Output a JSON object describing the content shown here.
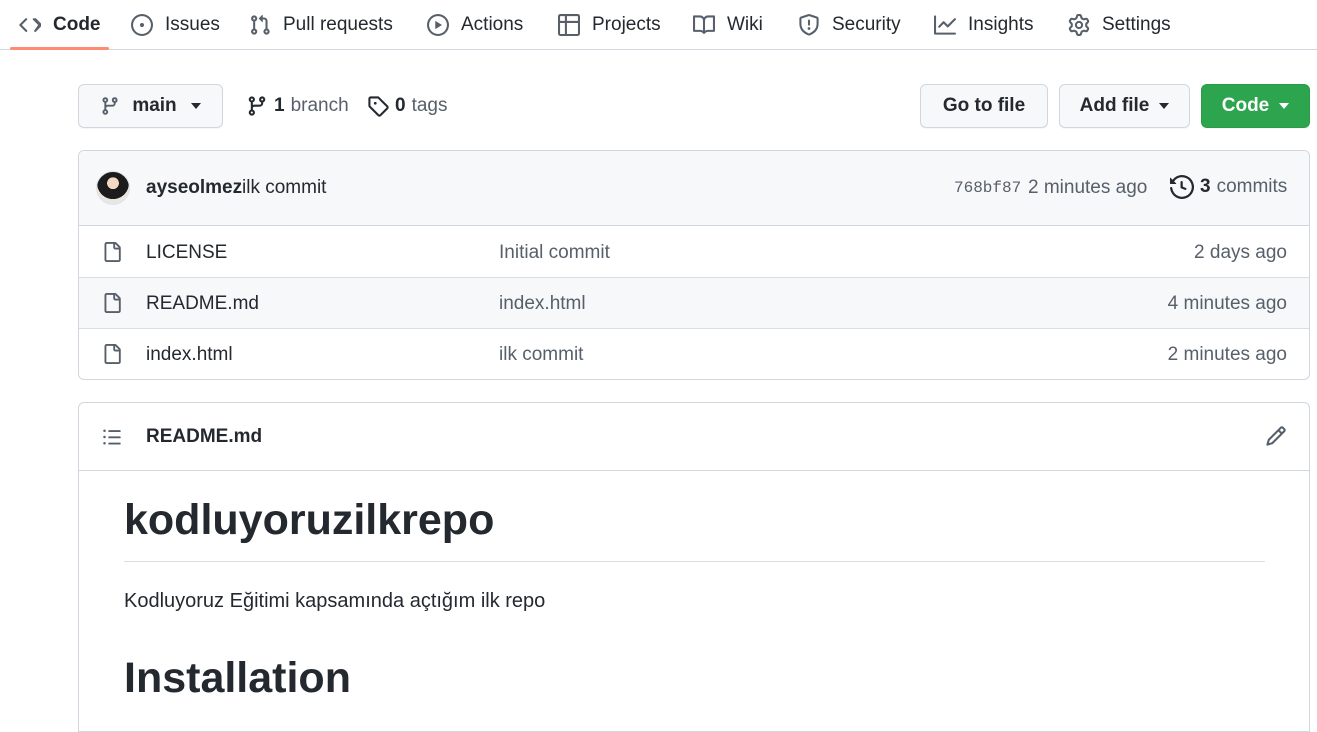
{
  "tabs": [
    {
      "label": "Code",
      "icon": "code-icon",
      "active": true
    },
    {
      "label": "Issues",
      "icon": "issue-opened-icon"
    },
    {
      "label": "Pull requests",
      "icon": "git-pull-request-icon"
    },
    {
      "label": "Actions",
      "icon": "play-icon"
    },
    {
      "label": "Projects",
      "icon": "table-icon"
    },
    {
      "label": "Wiki",
      "icon": "book-icon"
    },
    {
      "label": "Security",
      "icon": "shield-icon"
    },
    {
      "label": "Insights",
      "icon": "graph-icon"
    },
    {
      "label": "Settings",
      "icon": "gear-icon"
    }
  ],
  "branch_bar": {
    "current_branch": "main",
    "branch_count": "1",
    "branch_label": "branch",
    "tag_count": "0",
    "tag_label": "tags",
    "go_to_file": "Go to file",
    "add_file": "Add file",
    "code_button": "Code"
  },
  "latest_commit": {
    "author": "ayseolmez",
    "message": "ilk commit",
    "sha": "768bf87",
    "time": "2 minutes ago",
    "count": "3",
    "count_label": "commits"
  },
  "files": [
    {
      "name": "LICENSE",
      "message": "Initial commit",
      "age": "2 days ago",
      "icon": "file-icon"
    },
    {
      "name": "README.md",
      "message": "index.html",
      "age": "4 minutes ago",
      "icon": "file-icon"
    },
    {
      "name": "index.html",
      "message": "ilk commit",
      "age": "2 minutes ago",
      "icon": "file-icon"
    }
  ],
  "readme": {
    "filename": "README.md",
    "heading": "kodluyoruzilkrepo",
    "paragraph": "Kodluyoruz Eğitimi kapsamında açtığım ilk repo",
    "heading2": "Installation"
  },
  "colors": {
    "primary_button": "#2da44e",
    "active_tab_underline": "#fd8c73",
    "border": "#d0d7de",
    "muted_text": "#57606a"
  }
}
